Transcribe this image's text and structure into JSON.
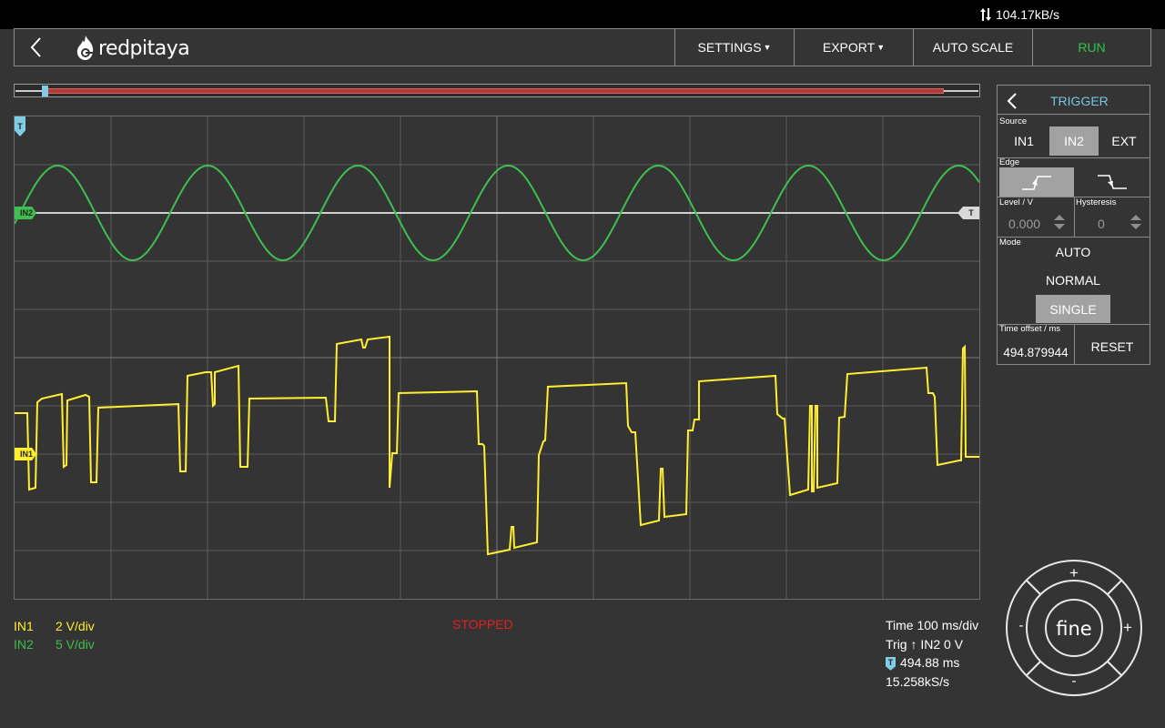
{
  "status": {
    "net_rate": "104.17kB/s"
  },
  "header": {
    "logo_text": "redpitaya",
    "settings_label": "SETTINGS",
    "export_label": "EXPORT",
    "autoscale_label": "AUTO SCALE",
    "run_label": "RUN"
  },
  "plot": {
    "trigger_marker": "T",
    "in2_marker": "IN2",
    "in1_marker": "IN1",
    "trig_level_marker": "T"
  },
  "channels": {
    "in1": {
      "name": "IN1",
      "scale": "2 V/div",
      "color": "#ffef2f"
    },
    "in2": {
      "name": "IN2",
      "scale": "5 V/div",
      "color": "#3fbf4e"
    }
  },
  "acq_state": "STOPPED",
  "time_info": {
    "timebase": "Time 100 ms/div",
    "trig": "Trig ↑ IN2 0 V",
    "offset": "494.88 ms",
    "sample_rate": "15.258kS/s"
  },
  "trigger_panel": {
    "title": "TRIGGER",
    "source_label": "Source",
    "sources": [
      "IN1",
      "IN2",
      "EXT"
    ],
    "selected_source": "IN2",
    "edge_label": "Edge",
    "selected_edge": "rising",
    "level_label": "Level / V",
    "level_value": "0.000",
    "hysteresis_label": "Hysteresis",
    "hysteresis_value": "0",
    "mode_label": "Mode",
    "modes": [
      "AUTO",
      "NORMAL",
      "SINGLE"
    ],
    "selected_mode": "SINGLE",
    "time_offset_label": "Time offset / ms",
    "time_offset_value": "494.879944",
    "reset_label": "RESET"
  },
  "jog": {
    "center_label": "fine",
    "plus": "+",
    "minus": "-"
  },
  "colors": {
    "accent": "#76c6e1",
    "run": "#31c64a",
    "stopped": "#e22121",
    "buffer_window": "#b73636"
  }
}
